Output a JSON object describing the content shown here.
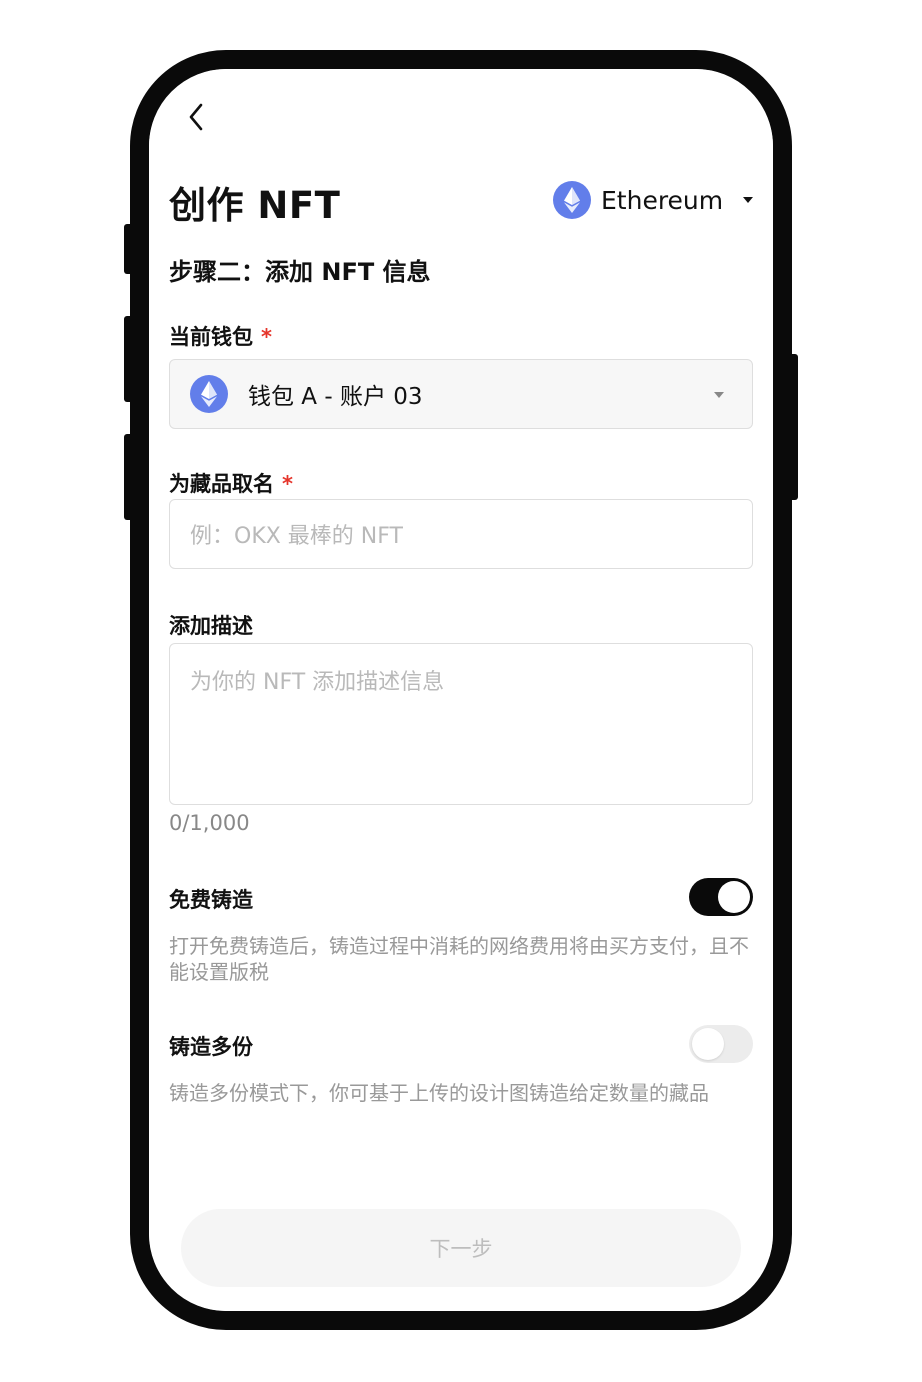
{
  "header": {
    "back_icon": "chevron-left-icon",
    "title": "创作 NFT",
    "network": {
      "label": "Ethereum",
      "icon": "ethereum-icon",
      "icon_color": "#627EEA"
    }
  },
  "step_title": "步骤二：添加 NFT 信息",
  "wallet_field": {
    "label": "当前钱包",
    "required_mark": "*",
    "value": "钱包 A - 账户 03",
    "icon": "ethereum-icon"
  },
  "name_field": {
    "label": "为藏品取名",
    "required_mark": "*",
    "placeholder": "例：OKX 最棒的 NFT"
  },
  "description_field": {
    "label": "添加描述",
    "placeholder": "为你的 NFT 添加描述信息",
    "counter": "0/1,000"
  },
  "free_mint": {
    "label": "免费铸造",
    "enabled": true,
    "description": "打开免费铸造后，铸造过程中消耗的网络费用将由买方支付，且不能设置版税"
  },
  "multi_mint": {
    "label": "铸造多份",
    "enabled": false,
    "description": "铸造多份模式下，你可基于上传的设计图铸造给定数量的藏品"
  },
  "next_button": {
    "label": "下一步",
    "enabled": false
  },
  "colors": {
    "accent": "#627EEA",
    "required": "#E5352B",
    "toggle_on": "#0A0A0A"
  }
}
